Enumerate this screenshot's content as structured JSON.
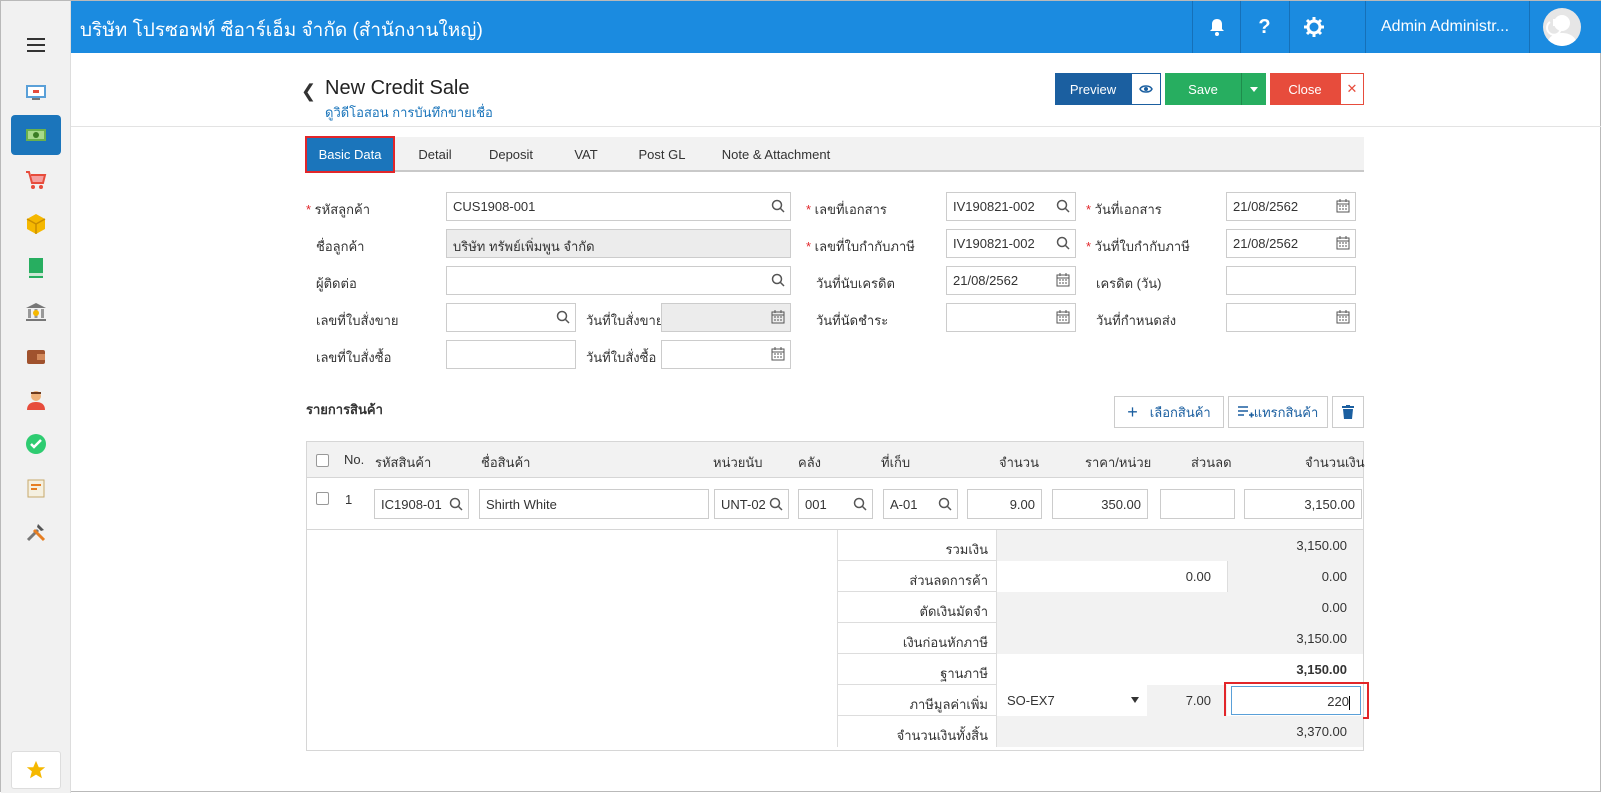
{
  "header": {
    "company": "บริษัท โปรซอฟท์ ซีอาร์เอ็ม จำกัด (สำนักงานใหญ่)",
    "user": "Admin Administr..."
  },
  "page": {
    "title": "New Credit Sale",
    "subtitle": "ดูวิดีโอสอน การบันทึกขายเชื่อ",
    "preview_label": "Preview",
    "save_label": "Save",
    "close_label": "Close"
  },
  "tabs": [
    "Basic Data",
    "Detail",
    "Deposit",
    "VAT",
    "Post GL",
    "Note & Attachment"
  ],
  "form": {
    "customer_code_label": "รหัสลูกค้า",
    "customer_code": "CUS1908-001",
    "customer_name_label": "ชื่อลูกค้า",
    "customer_name": "บริษัท ทรัพย์เพิ่มพูน จำกัด",
    "contact_label": "ผู้ติดต่อ",
    "contact": "",
    "so_no_label": "เลขที่ใบสั่งขาย",
    "so_no": "",
    "so_date_label": "วันที่ใบสั่งขาย",
    "so_date": "",
    "po_no_label": "เลขที่ใบสั่งซื้อ",
    "po_no": "",
    "po_date_label": "วันที่ใบสั่งซื้อ",
    "po_date": "",
    "doc_no_label": "เลขที่เอกสาร",
    "doc_no": "IV190821-002",
    "tax_inv_no_label": "เลขที่ใบกำกับภาษี",
    "tax_inv_no": "IV190821-002",
    "credit_start_label": "วันที่นับเครดิต",
    "credit_start": "21/08/2562",
    "due_date_label": "วันที่นัดชำระ",
    "due_date": "",
    "doc_date_label": "วันที่เอกสาร",
    "doc_date": "21/08/2562",
    "tax_inv_date_label": "วันที่ใบกำกับภาษี",
    "tax_inv_date": "21/08/2562",
    "credit_days_label": "เครดิต (วัน)",
    "credit_days": "",
    "delivery_date_label": "วันที่กำหนดส่ง",
    "delivery_date": ""
  },
  "items": {
    "section_title": "รายการสินค้า",
    "select_product_label": "เลือกสินค้า",
    "insert_product_label": "แทรกสินค้า",
    "columns": [
      "No.",
      "รหัสสินค้า",
      "ชื่อสินค้า",
      "หน่วยนับ",
      "คลัง",
      "ที่เก็บ",
      "จำนวน",
      "ราคา/หน่วย",
      "ส่วนลด",
      "จำนวนเงิน"
    ],
    "rows": [
      {
        "no": "1",
        "code": "IC1908-01",
        "name": "Shirth White",
        "unit": "UNT-02",
        "warehouse": "001",
        "location": "A-01",
        "qty": "9.00",
        "price": "350.00",
        "discount": "",
        "amount": "3,150.00"
      }
    ]
  },
  "summary": {
    "total_label": "รวมเงิน",
    "total": "3,150.00",
    "trade_discount_label": "ส่วนลดการค้า",
    "trade_discount_input": "0.00",
    "trade_discount": "0.00",
    "deposit_label": "ตัดเงินมัดจำ",
    "deposit": "0.00",
    "before_tax_label": "เงินก่อนหักภาษี",
    "before_tax": "3,150.00",
    "tax_base_label": "ฐานภาษี",
    "tax_base": "3,150.00",
    "vat_label": "ภาษีมูลค่าเพิ่ม",
    "vat_code": "SO-EX7",
    "vat_rate": "7.00",
    "vat_amount": "220",
    "grand_total_label": "จำนวนเงินทั้งสิ้น",
    "grand_total": "3,370.00"
  },
  "colors": {
    "topbar": "#1b8be0",
    "primary": "#1b75bb",
    "save": "#27ae60",
    "close": "#e74c3c",
    "highlight": "#e2262a"
  }
}
